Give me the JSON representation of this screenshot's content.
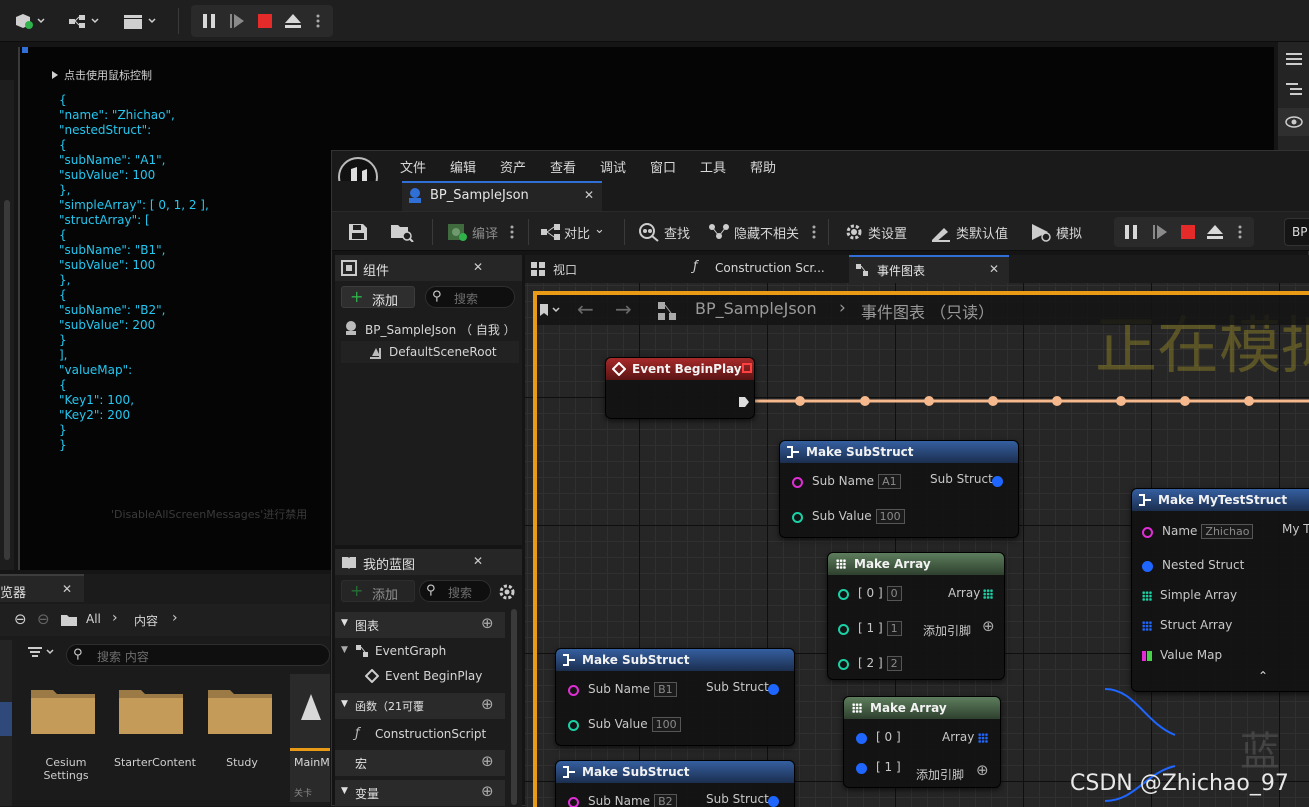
{
  "viewport": {
    "tip": "点击使用鼠标控制",
    "json_lines": "{\n\"name\": \"Zhichao\",\n\"nestedStruct\":\n{\n\"subName\": \"A1\",\n\"subValue\": 100\n},\n\"simpleArray\": [ 0, 1, 2 ],\n\"structArray\": [\n{\n\"subName\": \"B1\",\n\"subValue\": 100\n},\n{\n\"subName\": \"B2\",\n\"subValue\": 200\n}\n],\n\"valueMap\":\n{\n\"Key1\": 100,\n\"Key2\": 200\n}\n}",
    "faded_message": "'DisableAllScreenMessages'进行禁用"
  },
  "content_browser": {
    "tab_label": "览器",
    "path_all": "All",
    "path_content": "内容",
    "search_placeholder": "搜索 内容",
    "folders": [
      {
        "label": "Cesium\nSettings"
      },
      {
        "label": "StarterContent"
      },
      {
        "label": "Study"
      }
    ],
    "asset_label": "MainM",
    "asset_sublabel": "关卡"
  },
  "bp_window": {
    "menu": [
      "文件",
      "编辑",
      "资产",
      "查看",
      "调试",
      "窗口",
      "工具",
      "帮助"
    ],
    "doc_tab": "BP_SampleJson",
    "toolbar": {
      "compile": "编译",
      "diff": "对比",
      "find": "查找",
      "hide_unrelated": "隐藏不相关",
      "class_settings": "类设置",
      "class_defaults": "类默认值",
      "simulate": "模拟",
      "bp_short": "BP"
    },
    "components": {
      "title": "组件",
      "add": "添加",
      "search": "搜索",
      "root_item": "BP_SampleJson （ 自我 ）",
      "child_item": "DefaultSceneRoot"
    },
    "my_blueprint": {
      "title": "我的蓝图",
      "add": "添加",
      "search": "搜索",
      "sections": {
        "graphs": "图表",
        "functions": "函数（21可覆",
        "macros": "宏",
        "variables": "变量"
      },
      "event_graph": "EventGraph",
      "event_begin_play": "Event BeginPlay",
      "construction_script": "ConstructionScript"
    },
    "graph_tabs": {
      "viewport": "视口",
      "construction": "Construction Scr...",
      "event_graph": "事件图表"
    },
    "graph": {
      "breadcrumb_bp": "BP_SampleJson",
      "breadcrumb_graph": "事件图表 （只读）",
      "sim_watermark": "正在模拟",
      "csdn_watermark": "CSDN @Zhichao_97",
      "corner_watermark": "蓝"
    },
    "nodes": {
      "begin_play": {
        "title": "Event BeginPlay"
      },
      "make_sub_a": {
        "title": "Make SubStruct",
        "sub_name": "Sub Name",
        "sub_name_val": "A1",
        "sub_value": "Sub Value",
        "sub_value_val": "100",
        "out": "Sub Struct"
      },
      "make_array_1": {
        "title": "Make Array",
        "p0": "[ 0 ]",
        "v0": "0",
        "p1": "[ 1 ]",
        "v1": "1",
        "p2": "[ 2 ]",
        "v2": "2",
        "out": "Array",
        "add_pin": "添加引脚"
      },
      "make_sub_b1": {
        "title": "Make SubStruct",
        "sub_name": "Sub Name",
        "sub_name_val": "B1",
        "sub_value": "Sub Value",
        "sub_value_val": "100",
        "out": "Sub Struct"
      },
      "make_array_2": {
        "title": "Make Array",
        "p0": "[ 0 ]",
        "p1": "[ 1 ]",
        "out": "Array",
        "add_pin": "添加引脚"
      },
      "make_sub_b2": {
        "title": "Make SubStruct",
        "sub_name": "Sub Name",
        "sub_name_val": "B2",
        "out": "Sub Struct"
      },
      "make_test_struct": {
        "title": "Make MyTestStruct",
        "name": "Name",
        "name_val": "Zhichao",
        "out_partial": "My T",
        "nested": "Nested Struct",
        "simple_array": "Simple Array",
        "struct_array": "Struct Array",
        "value_map": "Value Map"
      }
    }
  },
  "colors": {
    "exec_wire": "#f5b98d",
    "struct_wire": "#1f66ff",
    "array_wire": "#1ad1a5",
    "map_wire": "#e02dd6",
    "simulate_border": "#e99b16"
  }
}
